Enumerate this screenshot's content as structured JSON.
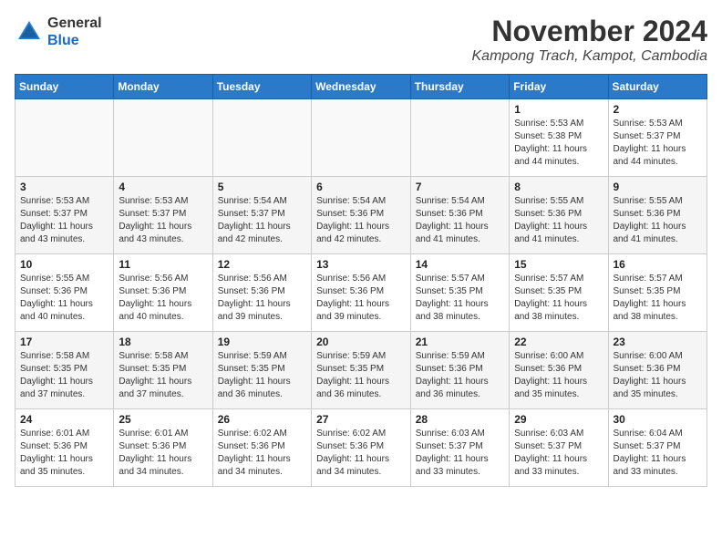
{
  "header": {
    "logo": {
      "line1": "General",
      "line2": "Blue"
    },
    "title": "November 2024",
    "location": "Kampong Trach, Kampot, Cambodia"
  },
  "calendar": {
    "weekdays": [
      "Sunday",
      "Monday",
      "Tuesday",
      "Wednesday",
      "Thursday",
      "Friday",
      "Saturday"
    ],
    "weeks": [
      [
        {
          "day": "",
          "info": ""
        },
        {
          "day": "",
          "info": ""
        },
        {
          "day": "",
          "info": ""
        },
        {
          "day": "",
          "info": ""
        },
        {
          "day": "",
          "info": ""
        },
        {
          "day": "1",
          "info": "Sunrise: 5:53 AM\nSunset: 5:38 PM\nDaylight: 11 hours\nand 44 minutes."
        },
        {
          "day": "2",
          "info": "Sunrise: 5:53 AM\nSunset: 5:37 PM\nDaylight: 11 hours\nand 44 minutes."
        }
      ],
      [
        {
          "day": "3",
          "info": "Sunrise: 5:53 AM\nSunset: 5:37 PM\nDaylight: 11 hours\nand 43 minutes."
        },
        {
          "day": "4",
          "info": "Sunrise: 5:53 AM\nSunset: 5:37 PM\nDaylight: 11 hours\nand 43 minutes."
        },
        {
          "day": "5",
          "info": "Sunrise: 5:54 AM\nSunset: 5:37 PM\nDaylight: 11 hours\nand 42 minutes."
        },
        {
          "day": "6",
          "info": "Sunrise: 5:54 AM\nSunset: 5:36 PM\nDaylight: 11 hours\nand 42 minutes."
        },
        {
          "day": "7",
          "info": "Sunrise: 5:54 AM\nSunset: 5:36 PM\nDaylight: 11 hours\nand 41 minutes."
        },
        {
          "day": "8",
          "info": "Sunrise: 5:55 AM\nSunset: 5:36 PM\nDaylight: 11 hours\nand 41 minutes."
        },
        {
          "day": "9",
          "info": "Sunrise: 5:55 AM\nSunset: 5:36 PM\nDaylight: 11 hours\nand 41 minutes."
        }
      ],
      [
        {
          "day": "10",
          "info": "Sunrise: 5:55 AM\nSunset: 5:36 PM\nDaylight: 11 hours\nand 40 minutes."
        },
        {
          "day": "11",
          "info": "Sunrise: 5:56 AM\nSunset: 5:36 PM\nDaylight: 11 hours\nand 40 minutes."
        },
        {
          "day": "12",
          "info": "Sunrise: 5:56 AM\nSunset: 5:36 PM\nDaylight: 11 hours\nand 39 minutes."
        },
        {
          "day": "13",
          "info": "Sunrise: 5:56 AM\nSunset: 5:36 PM\nDaylight: 11 hours\nand 39 minutes."
        },
        {
          "day": "14",
          "info": "Sunrise: 5:57 AM\nSunset: 5:35 PM\nDaylight: 11 hours\nand 38 minutes."
        },
        {
          "day": "15",
          "info": "Sunrise: 5:57 AM\nSunset: 5:35 PM\nDaylight: 11 hours\nand 38 minutes."
        },
        {
          "day": "16",
          "info": "Sunrise: 5:57 AM\nSunset: 5:35 PM\nDaylight: 11 hours\nand 38 minutes."
        }
      ],
      [
        {
          "day": "17",
          "info": "Sunrise: 5:58 AM\nSunset: 5:35 PM\nDaylight: 11 hours\nand 37 minutes."
        },
        {
          "day": "18",
          "info": "Sunrise: 5:58 AM\nSunset: 5:35 PM\nDaylight: 11 hours\nand 37 minutes."
        },
        {
          "day": "19",
          "info": "Sunrise: 5:59 AM\nSunset: 5:35 PM\nDaylight: 11 hours\nand 36 minutes."
        },
        {
          "day": "20",
          "info": "Sunrise: 5:59 AM\nSunset: 5:35 PM\nDaylight: 11 hours\nand 36 minutes."
        },
        {
          "day": "21",
          "info": "Sunrise: 5:59 AM\nSunset: 5:36 PM\nDaylight: 11 hours\nand 36 minutes."
        },
        {
          "day": "22",
          "info": "Sunrise: 6:00 AM\nSunset: 5:36 PM\nDaylight: 11 hours\nand 35 minutes."
        },
        {
          "day": "23",
          "info": "Sunrise: 6:00 AM\nSunset: 5:36 PM\nDaylight: 11 hours\nand 35 minutes."
        }
      ],
      [
        {
          "day": "24",
          "info": "Sunrise: 6:01 AM\nSunset: 5:36 PM\nDaylight: 11 hours\nand 35 minutes."
        },
        {
          "day": "25",
          "info": "Sunrise: 6:01 AM\nSunset: 5:36 PM\nDaylight: 11 hours\nand 34 minutes."
        },
        {
          "day": "26",
          "info": "Sunrise: 6:02 AM\nSunset: 5:36 PM\nDaylight: 11 hours\nand 34 minutes."
        },
        {
          "day": "27",
          "info": "Sunrise: 6:02 AM\nSunset: 5:36 PM\nDaylight: 11 hours\nand 34 minutes."
        },
        {
          "day": "28",
          "info": "Sunrise: 6:03 AM\nSunset: 5:37 PM\nDaylight: 11 hours\nand 33 minutes."
        },
        {
          "day": "29",
          "info": "Sunrise: 6:03 AM\nSunset: 5:37 PM\nDaylight: 11 hours\nand 33 minutes."
        },
        {
          "day": "30",
          "info": "Sunrise: 6:04 AM\nSunset: 5:37 PM\nDaylight: 11 hours\nand 33 minutes."
        }
      ]
    ]
  }
}
